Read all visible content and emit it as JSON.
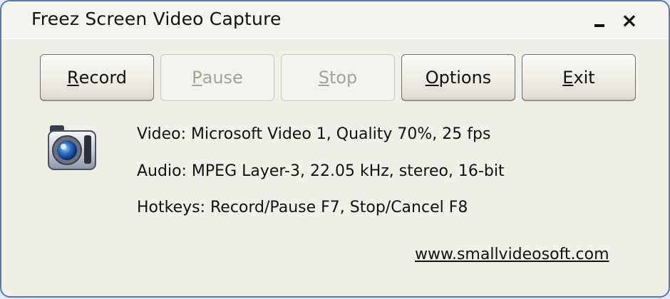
{
  "window": {
    "title": "Freez Screen Video Capture",
    "minimize_icon": "minimize-icon",
    "close_label": "×"
  },
  "buttons": [
    {
      "mnemonic": "R",
      "rest": "ecord",
      "enabled": true
    },
    {
      "mnemonic": "P",
      "rest": "ause",
      "enabled": false
    },
    {
      "mnemonic": "S",
      "rest": "top",
      "enabled": false
    },
    {
      "mnemonic": "O",
      "rest": "ptions",
      "enabled": true
    },
    {
      "mnemonic": "E",
      "rest": "xit",
      "enabled": true
    }
  ],
  "info": {
    "video": "Video: Microsoft Video 1, Quality 70%, 25 fps",
    "audio": "Audio: MPEG Layer-3, 22.05 kHz, stereo, 16-bit",
    "hotkeys": "Hotkeys: Record/Pause F7, Stop/Cancel F8"
  },
  "website_link": "www.smallvideosoft.com",
  "icons": {
    "app": "camera-icon"
  },
  "colors": {
    "frame": "#5a79b4",
    "dialog_bg": "#f0efe8",
    "disabled_text": "#a5a49b"
  }
}
